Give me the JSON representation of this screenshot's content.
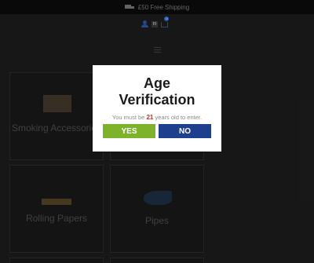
{
  "topbar": {
    "shipping_text": "£50 Free Shipping",
    "icon": "truck-icon"
  },
  "header": {
    "account_icon": "user-icon",
    "language_flag": "FI",
    "cart_icon": "cart-icon",
    "cart_count": "0",
    "menu_icon": "hamburger-menu-icon"
  },
  "categories": [
    {
      "label": "Smoking Accessories"
    },
    {
      "label": ""
    },
    {
      "label": "Rolling Papers"
    },
    {
      "label": "Pipes"
    }
  ],
  "modal": {
    "title_line1": "Age",
    "title_line2": "Verification",
    "message_prefix": "You must be",
    "age": "21",
    "message_suffix": "years old to enter.",
    "yes_label": "YES",
    "no_label": "NO"
  },
  "colors": {
    "yes_button": "#7cb32a",
    "no_button": "#1d3f8e",
    "age_highlight": "#e02020",
    "background": "#191919"
  }
}
